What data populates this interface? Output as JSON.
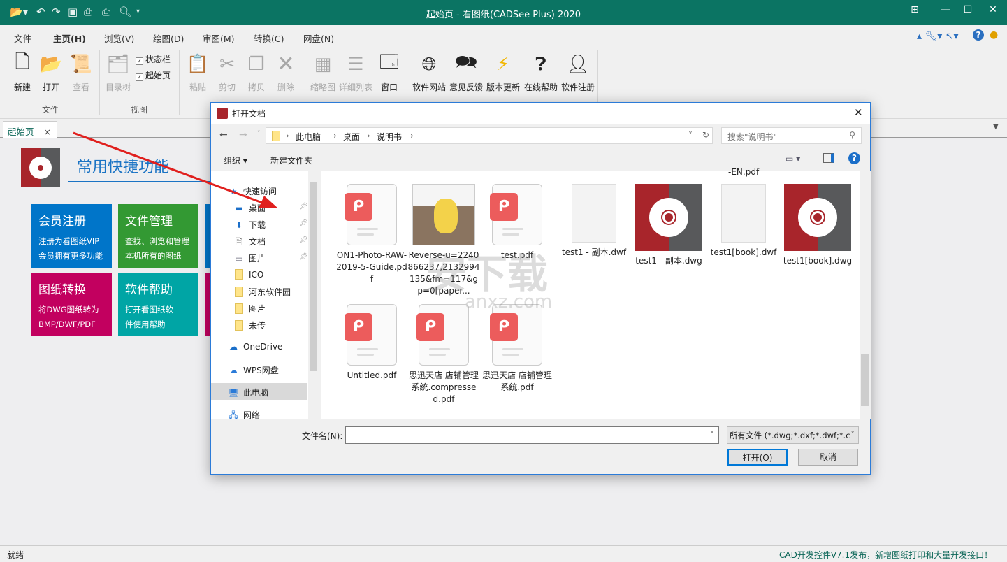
{
  "window": {
    "title": "起始页 - 看图纸(CADSee Plus) 2020",
    "quick_access": [
      "folder-open-icon",
      "undo-icon",
      "redo-icon",
      "save-icon",
      "print-icon",
      "batch-print-icon",
      "preview-icon"
    ]
  },
  "menu": {
    "tabs": [
      "文件",
      "主页(H)",
      "浏览(V)",
      "绘图(D)",
      "审图(M)",
      "转换(C)",
      "网盘(N)"
    ],
    "active": "主页(H)"
  },
  "ribbon": {
    "file_group": {
      "label": "文件",
      "buttons": [
        "新建",
        "打开",
        "查看"
      ]
    },
    "view_group": {
      "label": "视图",
      "tree": "目录树",
      "checks": [
        {
          "label": "状态栏",
          "checked": true
        },
        {
          "label": "起始页",
          "checked": true
        }
      ]
    },
    "edit_buttons": [
      "粘贴",
      "剪切",
      "拷贝",
      "删除"
    ],
    "layout_buttons": [
      "缩略图",
      "详细列表",
      "窗口"
    ],
    "web_buttons": [
      "软件网站",
      "意见反馈",
      "版本更新",
      "在线帮助",
      "软件注册"
    ]
  },
  "doc_tab": {
    "label": "起始页",
    "close": "×"
  },
  "start_page": {
    "heading": "常用快捷功能",
    "tiles": [
      {
        "title": "会员注册",
        "line1": "注册为看图纸VIP",
        "line2": "会员拥有更多功能",
        "color": "#0075c9"
      },
      {
        "title": "文件管理",
        "line1": "查找、浏览和管理",
        "line2": "本机所有的图纸",
        "color": "#339933"
      },
      {
        "title": "图纸转换",
        "line1": "将DWG图纸转为",
        "line2": "BMP/DWF/PDF",
        "color": "#c2005f"
      },
      {
        "title": "软件帮助",
        "line1": "打开看图纸软",
        "line2": "件使用帮助",
        "color": "#00a5a5"
      }
    ]
  },
  "dialog": {
    "title": "打开文档",
    "breadcrumb": [
      "此电脑",
      "桌面",
      "说明书"
    ],
    "search_placeholder": "搜索\"说明书\"",
    "organize": "组织 ▾",
    "new_folder": "新建文件夹",
    "nav": [
      {
        "label": "快速访问",
        "icon": "star-icon"
      },
      {
        "label": "桌面",
        "icon": "desktop-icon",
        "pinned": true
      },
      {
        "label": "下载",
        "icon": "download-icon",
        "pinned": true
      },
      {
        "label": "文档",
        "icon": "document-icon",
        "pinned": true
      },
      {
        "label": "图片",
        "icon": "picture-icon",
        "pinned": true
      },
      {
        "label": "ICO",
        "icon": "folder-icon"
      },
      {
        "label": "河东软件园",
        "icon": "folder-icon"
      },
      {
        "label": "图片",
        "icon": "folder-icon"
      },
      {
        "label": "未传",
        "icon": "folder-icon"
      },
      {
        "label": "OneDrive",
        "icon": "cloud-icon"
      },
      {
        "label": "WPS网盘",
        "icon": "wps-cloud-icon"
      },
      {
        "label": "此电脑",
        "icon": "computer-icon",
        "selected": true
      },
      {
        "label": "网络",
        "icon": "network-icon"
      }
    ],
    "partial_label": "-EN.pdf",
    "files": [
      {
        "name": "ON1-Photo-RAW-2019-5-Guide.pdf",
        "type": "pdf"
      },
      {
        "name": "Reverse-u=2240866237,2132994135&fm=117&gp=0[paper...",
        "type": "image"
      },
      {
        "name": "test.pdf",
        "type": "pdf"
      },
      {
        "name": "test1 - 副本.dwf",
        "type": "blank"
      },
      {
        "name": "test1 - 副本.dwg",
        "type": "dwg"
      },
      {
        "name": "test1[book].dwf",
        "type": "blank"
      },
      {
        "name": "test1[book].dwg",
        "type": "dwg"
      },
      {
        "name": "Untitled.pdf",
        "type": "pdf"
      },
      {
        "name": "思迅天店 店铺管理系统.compressed.pdf",
        "type": "pdf"
      },
      {
        "name": "思迅天店 店铺管理系统.pdf",
        "type": "pdf"
      }
    ],
    "filename_label": "文件名(N):",
    "filename_value": "",
    "filter": "所有文件 (*.dwg;*.dxf;*.dwf;*.c",
    "open": "打开(O)",
    "cancel": "取消"
  },
  "watermark": {
    "cn": "安下载",
    "en": "anxz.com"
  },
  "status": {
    "left": "就绪",
    "link": "CAD开发控件V7.1发布，新增图纸打印和大量开发接口！"
  }
}
